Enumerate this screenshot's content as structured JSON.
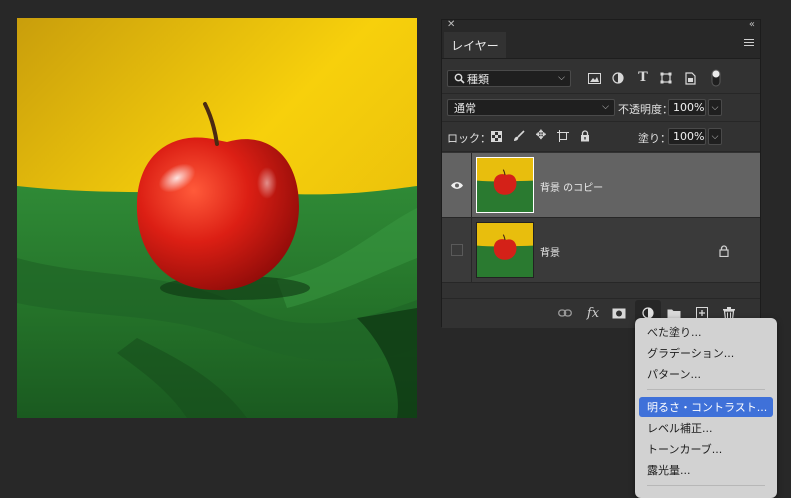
{
  "panel": {
    "tab_label": "レイヤー",
    "filter": {
      "label": "種類"
    },
    "blend_mode": "通常",
    "opacity_label": "不透明度：",
    "opacity_value": "100%",
    "lock_label": "ロック：",
    "fill_label": "塗り：",
    "fill_value": "100%",
    "layers": [
      {
        "name": "背景 のコピー",
        "visible": true,
        "locked": false,
        "selected": true
      },
      {
        "name": "背景",
        "visible": false,
        "locked": true,
        "selected": false
      }
    ]
  },
  "menu": {
    "items": [
      {
        "label": "べた塗り..."
      },
      {
        "label": "グラデーション..."
      },
      {
        "label": "パターン..."
      },
      {
        "label": "明るさ・コントラスト..."
      },
      {
        "label": "レベル補正..."
      },
      {
        "label": "トーンカーブ..."
      },
      {
        "label": "露光量..."
      }
    ],
    "active_index": 3
  },
  "colors": {
    "background": "#282828",
    "panel": "#323232",
    "selected_layer": "#636363",
    "menu_highlight": "#3f71d9",
    "wall": "#f1c40f",
    "cloth": "#2e7d32",
    "apple": "#d9261c"
  },
  "icons": [
    "close-icon",
    "collapse-icon",
    "panel-menu-icon",
    "search-icon",
    "image-filter-icon",
    "adjustment-filter-icon",
    "type-filter-icon",
    "shape-filter-icon",
    "smart-object-filter-icon",
    "filter-toggle-icon",
    "lock-transparent-icon",
    "lock-paint-icon",
    "lock-position-icon",
    "lock-artboard-icon",
    "lock-all-icon",
    "eye-icon",
    "lock-icon",
    "link-icon",
    "fx-icon",
    "mask-icon",
    "adjustment-layer-icon",
    "folder-icon",
    "new-layer-icon",
    "trash-icon"
  ]
}
